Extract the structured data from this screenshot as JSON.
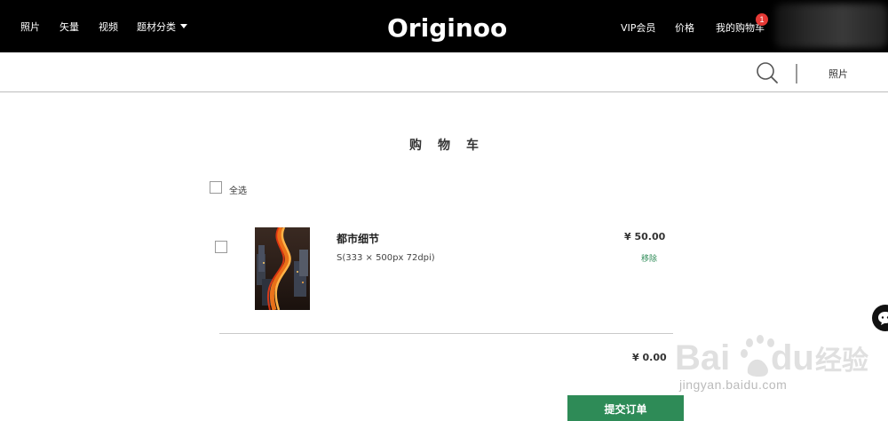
{
  "nav": {
    "left": [
      "照片",
      "矢量",
      "视频",
      "题材分类"
    ],
    "logo_text": "Originoo",
    "vip": "VIP会员",
    "price": "价格",
    "cart": "我的购物车",
    "cart_count": "1"
  },
  "subbar": {
    "type_label": "照片"
  },
  "cart": {
    "title": "购物车",
    "select_all": "全选",
    "item": {
      "name": "都市细节",
      "spec": "S(333 × 500px 72dpi)",
      "price": "¥ 50.00",
      "remove": "移除"
    },
    "total": "¥ 0.00",
    "submit": "提交订单"
  },
  "watermark": {
    "text": "jingyan.baidu.com"
  },
  "colors": {
    "topbar": "#000000",
    "accent_green": "#2e8b57",
    "badge_red": "#e53935"
  },
  "icons": [
    "chevron-down-icon",
    "search-icon",
    "chat-icon"
  ]
}
